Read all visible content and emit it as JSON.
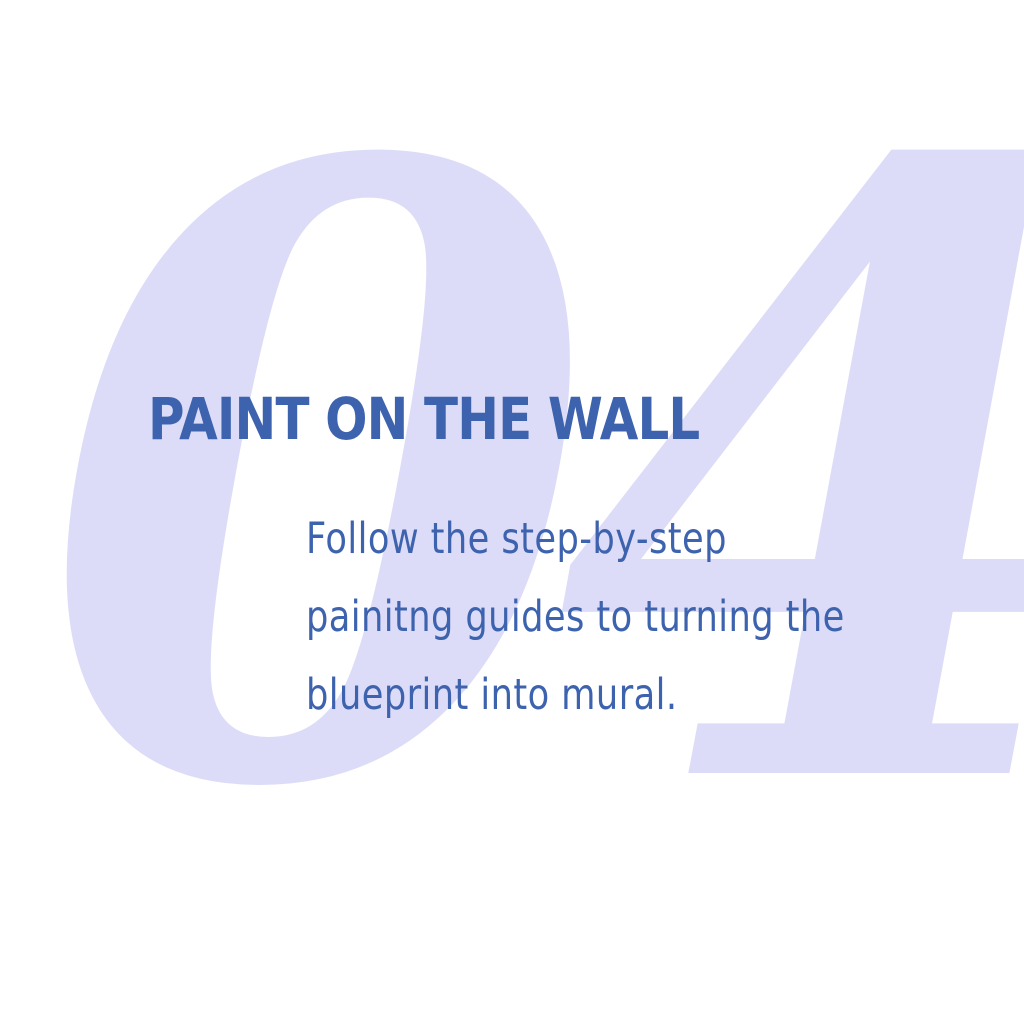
{
  "step": {
    "number": "04",
    "title": "PAINT ON THE WALL",
    "description_lines": [
      "Follow the step-by-step",
      "painitng guides to turning the",
      "blueprint into mural."
    ]
  },
  "colors": {
    "background": "#ffffff",
    "number_fill": "#dcdcf8",
    "text": "#3e63ae"
  }
}
